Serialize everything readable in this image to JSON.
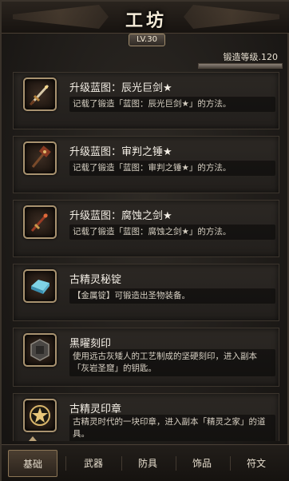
{
  "header": {
    "title": "工坊",
    "level": "LV.30"
  },
  "skill": {
    "label": "锻造等级.120",
    "progress": 1.0
  },
  "items": [
    {
      "title": "升级蓝图：辰光巨剑★",
      "desc": "记载了锻造「蓝图：辰光巨剑★」的方法。",
      "icon": "greatsword-icon"
    },
    {
      "title": "升级蓝图：审判之锤★",
      "desc": "记载了锻造「蓝图：审判之锤★」的方法。",
      "icon": "hammer-icon"
    },
    {
      "title": "升级蓝图：腐蚀之剑★",
      "desc": "记载了锻造「蓝图：腐蚀之剑★」的方法。",
      "icon": "sword-icon"
    },
    {
      "title": "古精灵秘锭",
      "desc": "【金属锭】可锻造出圣物装备。",
      "icon": "ingot-icon"
    },
    {
      "title": "黑曜刻印",
      "desc": "使用远古灰矮人的工艺制成的坚硬刻印，进入副本「灰岩圣窟」的钥匙。",
      "icon": "obsidian-seal-icon"
    },
    {
      "title": "古精灵印章",
      "desc": "古精灵时代的一块印章，进入副本「精灵之家」的道具。",
      "icon": "elven-seal-icon"
    }
  ],
  "tabs": [
    {
      "label": "基础",
      "active": true
    },
    {
      "label": "武器",
      "active": false
    },
    {
      "label": "防具",
      "active": false
    },
    {
      "label": "饰品",
      "active": false
    },
    {
      "label": "符文",
      "active": false
    }
  ]
}
